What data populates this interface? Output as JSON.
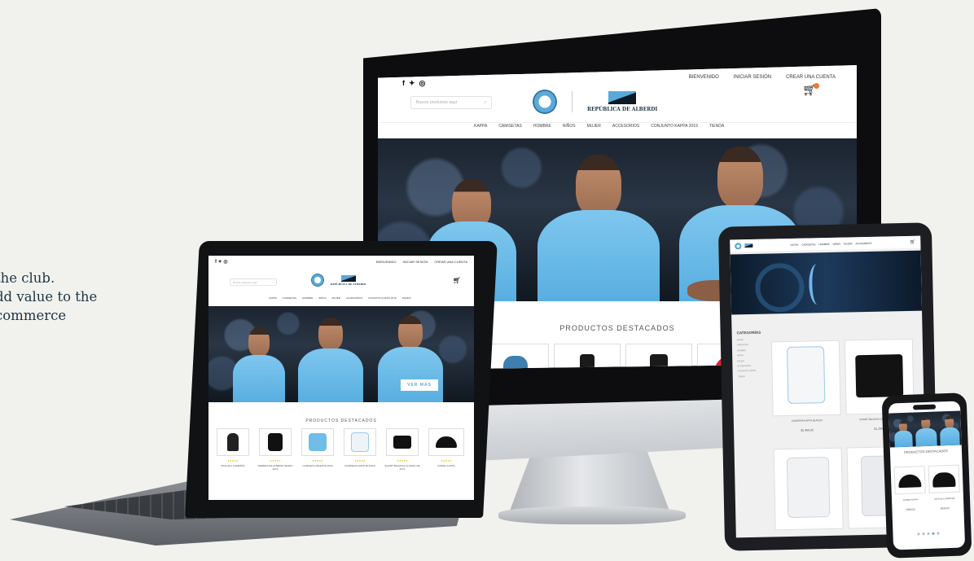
{
  "caption": {
    "lines": [
      "the club.",
      "dd value to the",
      "commerce"
    ]
  },
  "site": {
    "topbar": {
      "links": [
        "BIENVENIDO",
        "INICIAR SESIÓN",
        "CREAR UNA CUENTA"
      ],
      "social_icons": [
        "facebook-icon",
        "twitter-icon",
        "instagram-icon"
      ]
    },
    "search_placeholder": "Buscar productos aquí",
    "brand": "REPÚBLICA DE ALBERDI",
    "nav": [
      "KAPPA",
      "CAMISETAS",
      "HOMBRE",
      "NIÑOS",
      "MUJER",
      "ACCESORIOS",
      "CONJUNTO KAPPA 2019",
      "TIENDA"
    ],
    "hero_button": "VER MÁS",
    "featured_title": "PRODUCTOS DESTACADOS",
    "laptop_products": [
      {
        "name": "MOCHILA CAMPAÑA",
        "rating": "★★★★★"
      },
      {
        "name": "REMERA DE ALBERDI NEGRA ALTA",
        "rating": "★★★★★"
      },
      {
        "name": "CAMISETA CELESTE 2019",
        "rating": "★★★★★"
      },
      {
        "name": "CAMPERA KAPPA BLANCA",
        "rating": "★★★★★"
      },
      {
        "name": "SHORT BALDIVIA CLASSIC DE ALTA",
        "rating": "★★★★★"
      },
      {
        "name": "GORRA KAPPA",
        "rating": "★★★★★"
      }
    ],
    "tablet": {
      "categories_title": "CATEGORÍAS",
      "category_items": [
        "KAPPA",
        "CAMISETAS",
        "HOMBRE",
        "NIÑOS",
        "MUJER",
        "ACCESORIOS",
        "CONJUNTO KAPPA",
        "TIENDA"
      ],
      "products": [
        {
          "name": "CAMPERA KAPPA BLANCA",
          "price": "$2.999,00"
        },
        {
          "name": "SHORT BALDIVIA CLASSIC DE ALTA",
          "price": "$1.299,00"
        }
      ]
    },
    "phone": {
      "featured_title": "PRODUCTOS DESTACADOS",
      "products": [
        {
          "name": "GORRA KAPPA",
          "price": "$999,00"
        },
        {
          "name": "MOCHILA CAMPAÑA",
          "price": "$999,00"
        }
      ]
    }
  },
  "colors": {
    "accent": "#5aa9d8",
    "background": "#f1f2ee",
    "navy": "#1d3442"
  }
}
